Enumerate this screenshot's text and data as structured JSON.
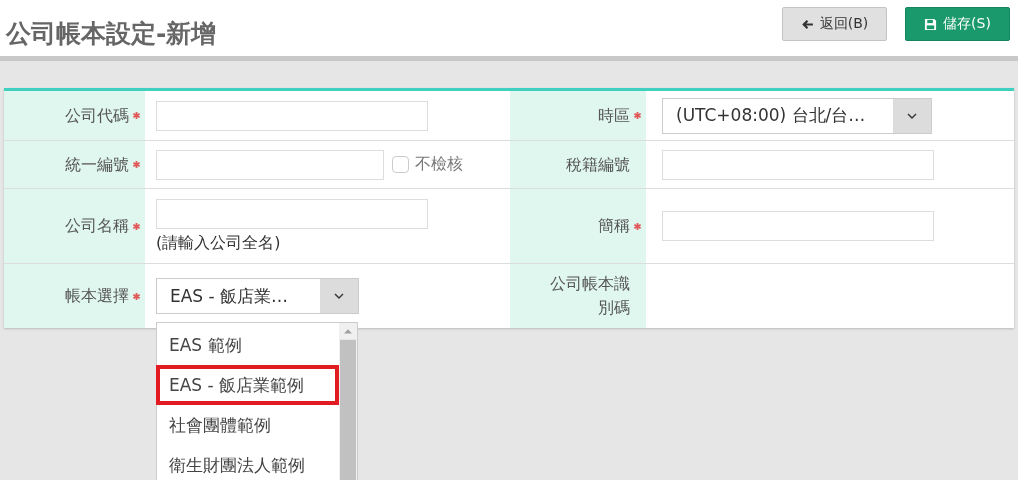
{
  "header": {
    "title": "公司帳本設定-新增",
    "buttons": [
      {
        "label": "返回(B)",
        "kind": "back"
      },
      {
        "label": "儲存(S)",
        "kind": "save"
      }
    ]
  },
  "form": {
    "fields": [
      {
        "label": "公司代碼",
        "required": true,
        "kind": "input"
      },
      {
        "label": "時區",
        "required": true,
        "kind": "select",
        "value": "(UTC+08:00) 台北/台…"
      },
      {
        "label": "統一編號",
        "required": true,
        "kind": "input",
        "checkbox": {
          "label": "不檢核",
          "checked": false
        }
      },
      {
        "label": "稅籍編號",
        "required": false,
        "kind": "input"
      },
      {
        "label": "公司名稱",
        "required": true,
        "kind": "input",
        "hint": "(請輸入公司全名)"
      },
      {
        "label": "簡稱",
        "required": true,
        "kind": "input"
      },
      {
        "label": "帳本選擇",
        "required": true,
        "kind": "select",
        "value": "EAS - 飯店業…",
        "expanded": true,
        "options": [
          {
            "label": "EAS 範例",
            "highlighted": false
          },
          {
            "label": "EAS - 飯店業範例",
            "highlighted": true
          },
          {
            "label": "社會團體範例",
            "highlighted": false
          },
          {
            "label": "衛生財團法人範例",
            "highlighted": false
          }
        ]
      },
      {
        "label": "公司帳本識別碼",
        "required": false,
        "kind": "empty"
      }
    ]
  }
}
